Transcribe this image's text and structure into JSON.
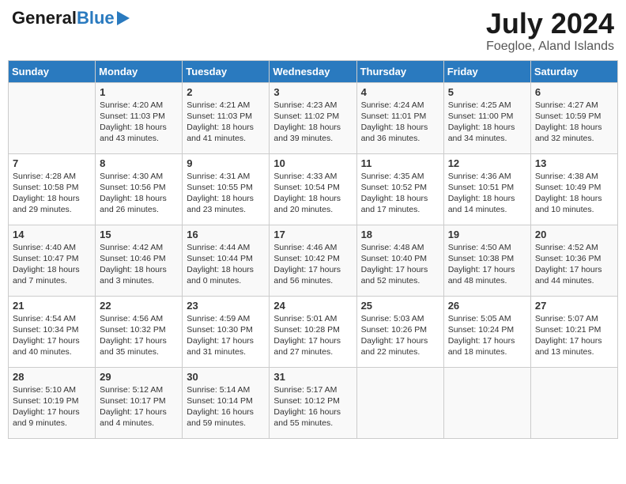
{
  "logo": {
    "general": "General",
    "blue": "Blue"
  },
  "title": {
    "month_year": "July 2024",
    "location": "Foegloe, Aland Islands"
  },
  "days_of_week": [
    "Sunday",
    "Monday",
    "Tuesday",
    "Wednesday",
    "Thursday",
    "Friday",
    "Saturday"
  ],
  "weeks": [
    [
      {
        "day": "",
        "content": ""
      },
      {
        "day": "1",
        "content": "Sunrise: 4:20 AM\nSunset: 11:03 PM\nDaylight: 18 hours\nand 43 minutes."
      },
      {
        "day": "2",
        "content": "Sunrise: 4:21 AM\nSunset: 11:03 PM\nDaylight: 18 hours\nand 41 minutes."
      },
      {
        "day": "3",
        "content": "Sunrise: 4:23 AM\nSunset: 11:02 PM\nDaylight: 18 hours\nand 39 minutes."
      },
      {
        "day": "4",
        "content": "Sunrise: 4:24 AM\nSunset: 11:01 PM\nDaylight: 18 hours\nand 36 minutes."
      },
      {
        "day": "5",
        "content": "Sunrise: 4:25 AM\nSunset: 11:00 PM\nDaylight: 18 hours\nand 34 minutes."
      },
      {
        "day": "6",
        "content": "Sunrise: 4:27 AM\nSunset: 10:59 PM\nDaylight: 18 hours\nand 32 minutes."
      }
    ],
    [
      {
        "day": "7",
        "content": "Sunrise: 4:28 AM\nSunset: 10:58 PM\nDaylight: 18 hours\nand 29 minutes."
      },
      {
        "day": "8",
        "content": "Sunrise: 4:30 AM\nSunset: 10:56 PM\nDaylight: 18 hours\nand 26 minutes."
      },
      {
        "day": "9",
        "content": "Sunrise: 4:31 AM\nSunset: 10:55 PM\nDaylight: 18 hours\nand 23 minutes."
      },
      {
        "day": "10",
        "content": "Sunrise: 4:33 AM\nSunset: 10:54 PM\nDaylight: 18 hours\nand 20 minutes."
      },
      {
        "day": "11",
        "content": "Sunrise: 4:35 AM\nSunset: 10:52 PM\nDaylight: 18 hours\nand 17 minutes."
      },
      {
        "day": "12",
        "content": "Sunrise: 4:36 AM\nSunset: 10:51 PM\nDaylight: 18 hours\nand 14 minutes."
      },
      {
        "day": "13",
        "content": "Sunrise: 4:38 AM\nSunset: 10:49 PM\nDaylight: 18 hours\nand 10 minutes."
      }
    ],
    [
      {
        "day": "14",
        "content": "Sunrise: 4:40 AM\nSunset: 10:47 PM\nDaylight: 18 hours\nand 7 minutes."
      },
      {
        "day": "15",
        "content": "Sunrise: 4:42 AM\nSunset: 10:46 PM\nDaylight: 18 hours\nand 3 minutes."
      },
      {
        "day": "16",
        "content": "Sunrise: 4:44 AM\nSunset: 10:44 PM\nDaylight: 18 hours\nand 0 minutes."
      },
      {
        "day": "17",
        "content": "Sunrise: 4:46 AM\nSunset: 10:42 PM\nDaylight: 17 hours\nand 56 minutes."
      },
      {
        "day": "18",
        "content": "Sunrise: 4:48 AM\nSunset: 10:40 PM\nDaylight: 17 hours\nand 52 minutes."
      },
      {
        "day": "19",
        "content": "Sunrise: 4:50 AM\nSunset: 10:38 PM\nDaylight: 17 hours\nand 48 minutes."
      },
      {
        "day": "20",
        "content": "Sunrise: 4:52 AM\nSunset: 10:36 PM\nDaylight: 17 hours\nand 44 minutes."
      }
    ],
    [
      {
        "day": "21",
        "content": "Sunrise: 4:54 AM\nSunset: 10:34 PM\nDaylight: 17 hours\nand 40 minutes."
      },
      {
        "day": "22",
        "content": "Sunrise: 4:56 AM\nSunset: 10:32 PM\nDaylight: 17 hours\nand 35 minutes."
      },
      {
        "day": "23",
        "content": "Sunrise: 4:59 AM\nSunset: 10:30 PM\nDaylight: 17 hours\nand 31 minutes."
      },
      {
        "day": "24",
        "content": "Sunrise: 5:01 AM\nSunset: 10:28 PM\nDaylight: 17 hours\nand 27 minutes."
      },
      {
        "day": "25",
        "content": "Sunrise: 5:03 AM\nSunset: 10:26 PM\nDaylight: 17 hours\nand 22 minutes."
      },
      {
        "day": "26",
        "content": "Sunrise: 5:05 AM\nSunset: 10:24 PM\nDaylight: 17 hours\nand 18 minutes."
      },
      {
        "day": "27",
        "content": "Sunrise: 5:07 AM\nSunset: 10:21 PM\nDaylight: 17 hours\nand 13 minutes."
      }
    ],
    [
      {
        "day": "28",
        "content": "Sunrise: 5:10 AM\nSunset: 10:19 PM\nDaylight: 17 hours\nand 9 minutes."
      },
      {
        "day": "29",
        "content": "Sunrise: 5:12 AM\nSunset: 10:17 PM\nDaylight: 17 hours\nand 4 minutes."
      },
      {
        "day": "30",
        "content": "Sunrise: 5:14 AM\nSunset: 10:14 PM\nDaylight: 16 hours\nand 59 minutes."
      },
      {
        "day": "31",
        "content": "Sunrise: 5:17 AM\nSunset: 10:12 PM\nDaylight: 16 hours\nand 55 minutes."
      },
      {
        "day": "",
        "content": ""
      },
      {
        "day": "",
        "content": ""
      },
      {
        "day": "",
        "content": ""
      }
    ]
  ]
}
